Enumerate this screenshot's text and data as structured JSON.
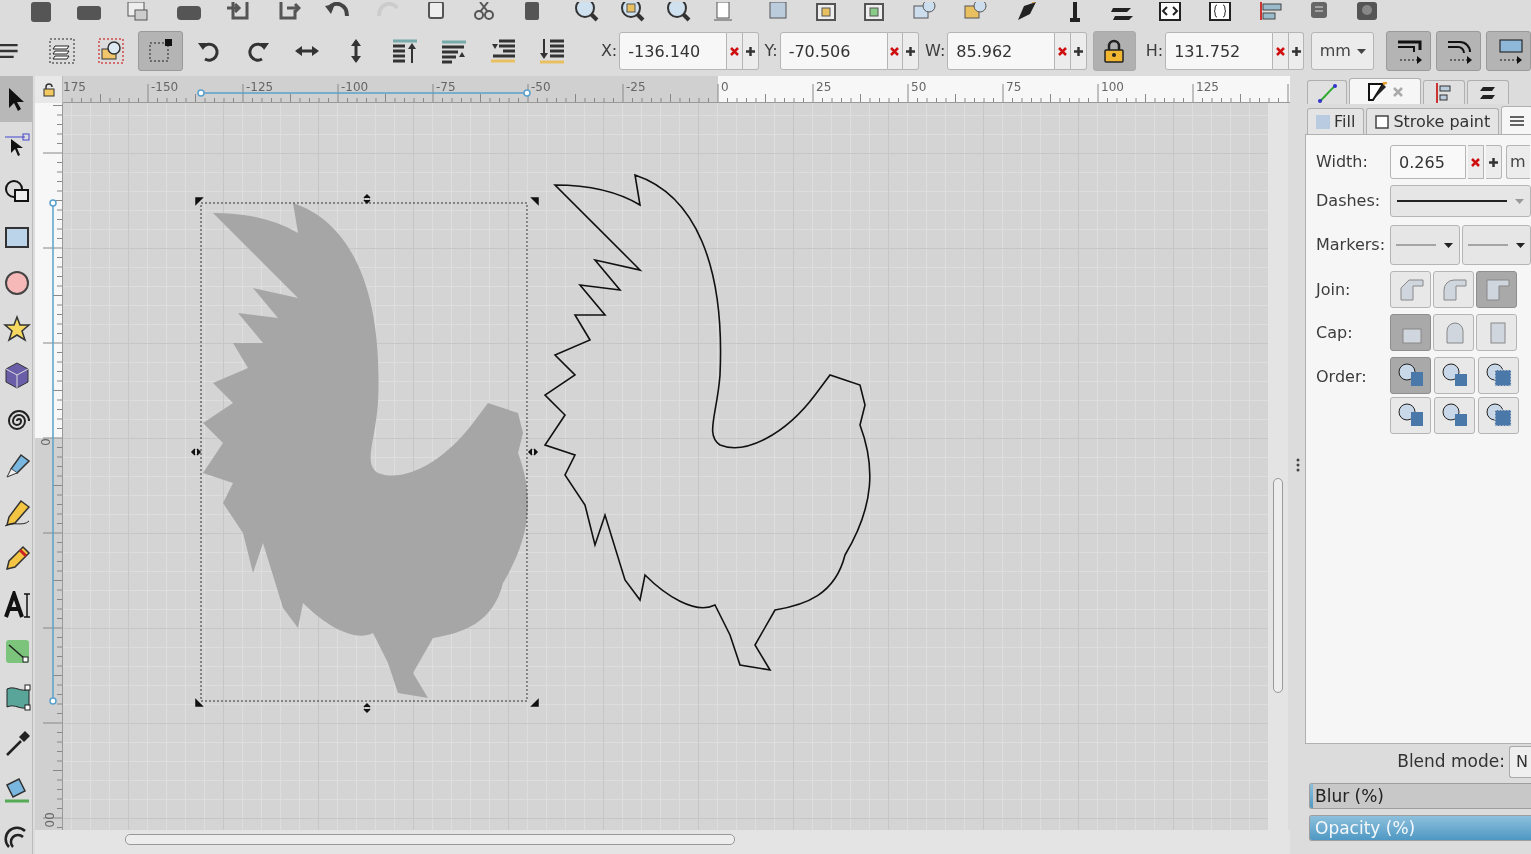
{
  "toolbar": {
    "mode_toggles": [
      {
        "kind": "layers",
        "on": false
      },
      {
        "kind": "zoom-select",
        "on": false
      },
      {
        "kind": "handles",
        "on": true
      }
    ],
    "fields": [
      {
        "label": "X:",
        "value": "-136.140"
      },
      {
        "label": "Y:",
        "value": "-70.506"
      },
      {
        "label": "W:",
        "value": "85.962"
      },
      {
        "label": "H:",
        "value": "131.752"
      }
    ],
    "lock": {
      "on": true
    },
    "unit": "mm",
    "affect_toggles": [
      {
        "kind": "stroke",
        "on": true
      },
      {
        "kind": "corners",
        "on": true
      },
      {
        "kind": "gradient",
        "on": true
      }
    ]
  },
  "tools": [
    {
      "kind": "selector",
      "selected": true
    },
    {
      "kind": "node",
      "selected": false
    },
    {
      "kind": "tweak",
      "selected": false
    },
    {
      "kind": "rect",
      "selected": false
    },
    {
      "kind": "ellipse",
      "selected": false
    },
    {
      "kind": "star",
      "selected": false
    },
    {
      "kind": "box3d",
      "selected": false
    },
    {
      "kind": "spiral",
      "selected": false
    },
    {
      "kind": "brush",
      "selected": false
    },
    {
      "kind": "pencil",
      "selected": false
    },
    {
      "kind": "pen",
      "selected": false
    },
    {
      "kind": "text",
      "selected": false
    },
    {
      "kind": "gradient",
      "selected": false
    },
    {
      "kind": "mesh",
      "selected": false
    },
    {
      "kind": "dropper",
      "selected": false
    },
    {
      "kind": "bucket",
      "selected": false
    },
    {
      "kind": "spray",
      "selected": false
    }
  ],
  "rulers": {
    "horizontal": [
      "175",
      "-150",
      "-125",
      "-100",
      "-75",
      "-50",
      "-25",
      "0",
      "25",
      "50",
      "75",
      "100",
      "125"
    ],
    "vertical": [
      "0",
      "00"
    ]
  },
  "panel": {
    "tabs": [
      {
        "kind": "path",
        "selected": false
      },
      {
        "kind": "fill-stroke",
        "selected": true
      },
      {
        "kind": "align",
        "selected": false
      },
      {
        "kind": "objects",
        "selected": false
      }
    ],
    "subtabs": [
      {
        "kind": "fill",
        "label": "Fill",
        "selected": false
      },
      {
        "kind": "stroke-paint",
        "label": "Stroke paint",
        "selected": false
      },
      {
        "kind": "stroke-style",
        "selected": true
      }
    ],
    "width": {
      "label": "Width:",
      "value": "0.265",
      "unit": "m"
    },
    "dashes": {
      "label": "Dashes:"
    },
    "markers": {
      "label": "Markers:"
    },
    "join": {
      "label": "Join:",
      "options": [
        {
          "kind": "bevel",
          "selected": false
        },
        {
          "kind": "round",
          "selected": false
        },
        {
          "kind": "miter",
          "selected": true
        }
      ]
    },
    "cap": {
      "label": "Cap:",
      "options": [
        {
          "kind": "butt",
          "selected": true
        },
        {
          "kind": "round",
          "selected": false
        },
        {
          "kind": "square",
          "selected": false
        }
      ]
    },
    "order": {
      "label": "Order:",
      "options": [
        {
          "selected": true
        },
        {
          "selected": false
        },
        {
          "selected": false
        },
        {
          "selected": false
        },
        {
          "selected": false
        },
        {
          "selected": false
        }
      ]
    },
    "blend_mode": {
      "label": "Blend mode:",
      "value": "N"
    },
    "blur": {
      "label": "Blur (%)",
      "level": 0
    },
    "opacity": {
      "label": "Opacity (%)",
      "level": 1
    }
  }
}
